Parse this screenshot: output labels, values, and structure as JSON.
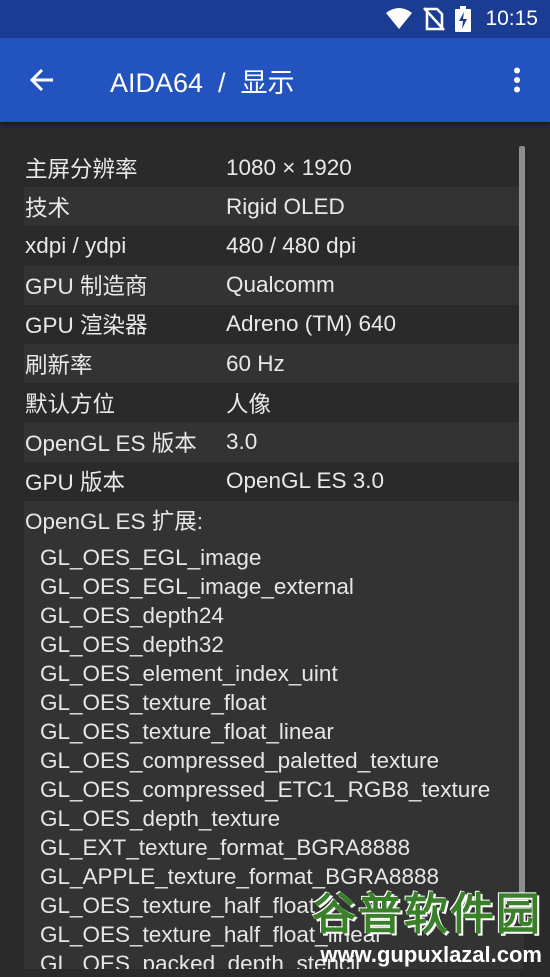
{
  "status_bar": {
    "time": "10:15",
    "icons": [
      "wifi-icon",
      "no-sim-icon",
      "battery-charging-icon"
    ]
  },
  "app_bar": {
    "title": "AIDA64  /  显示",
    "back_icon": "arrow-back-icon",
    "menu_icon": "more-vert-icon"
  },
  "rows": [
    {
      "key": "主屏分辨率",
      "value": "1080 × 1920"
    },
    {
      "key": "技术",
      "value": "Rigid OLED"
    },
    {
      "key": "xdpi / ydpi",
      "value": "480 / 480 dpi"
    },
    {
      "key": "GPU 制造商",
      "value": "Qualcomm"
    },
    {
      "key": "GPU 渲染器",
      "value": "Adreno (TM) 640"
    },
    {
      "key": "刷新率",
      "value": "60 Hz"
    },
    {
      "key": "默认方位",
      "value": "人像"
    },
    {
      "key": "OpenGL ES 版本",
      "value": "3.0"
    },
    {
      "key": "GPU 版本",
      "value": "OpenGL ES 3.0"
    }
  ],
  "extensions": {
    "title": "OpenGL ES 扩展:",
    "items": [
      "GL_OES_EGL_image",
      "GL_OES_EGL_image_external",
      "GL_OES_depth24",
      "GL_OES_depth32",
      "GL_OES_element_index_uint",
      "GL_OES_texture_float",
      "GL_OES_texture_float_linear",
      "GL_OES_compressed_paletted_texture",
      "GL_OES_compressed_ETC1_RGB8_texture",
      "GL_OES_depth_texture",
      "GL_EXT_texture_format_BGRA8888",
      "GL_APPLE_texture_format_BGRA8888",
      "GL_OES_texture_half_float",
      "GL_OES_texture_half_float_linear",
      "GL_OES_packed_depth_stencil"
    ]
  },
  "watermark": {
    "main": "谷普软件园",
    "url": "www.gupuxlazal.com"
  },
  "colors": {
    "status_bar": "#1a3d93",
    "app_bar": "#2253bf",
    "background": "#2a2a2a",
    "row_shade": "#333333",
    "watermark_green": "#3a7f2a"
  }
}
